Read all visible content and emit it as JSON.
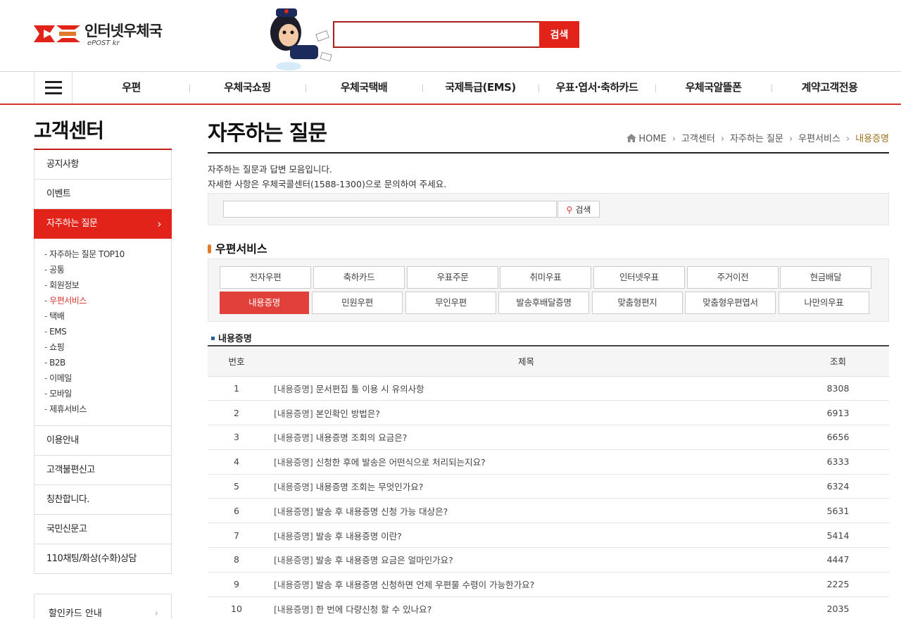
{
  "header": {
    "logo_text": "인터넷우체국",
    "logo_sub": "ePOST kr",
    "search_button": "검색",
    "search_value": ""
  },
  "gnb": {
    "items": [
      "우편",
      "우체국쇼핑",
      "우체국택배",
      "국제특급(EMS)",
      "우표·엽서·축하카드",
      "우체국알뜰폰",
      "계약고객전용"
    ]
  },
  "lnb": {
    "title": "고객센터",
    "items": [
      "공지사항",
      "이벤트",
      "자주하는 질문"
    ],
    "active_arrow": "›",
    "sub_items": [
      "자주하는 질문 TOP10",
      "공통",
      "회원정보",
      "우편서비스",
      "택배",
      "EMS",
      "쇼핑",
      "B2B",
      "이메일",
      "모바일",
      "제휴서비스"
    ],
    "items_after": [
      "이용안내",
      "고객불편신고",
      "칭찬합니다.",
      "국민신문고",
      "110채팅/화상(수화)상담"
    ],
    "bottom": "할인카드 안내"
  },
  "content": {
    "page_title": "자주하는 질문",
    "breadcrumb": [
      "HOME",
      "고객센터",
      "자주하는 질문",
      "우편서비스",
      "내용증명"
    ],
    "desc_line1": "자주하는 질문과 답변 모음입니다.",
    "desc_line2": "자세한 사항은 우체국콜센터(1588-1300)으로 문의하여 주세요.",
    "search_button": "검색",
    "category_title": "우편서비스",
    "categories_row1": [
      "전자우편",
      "축하카드",
      "우표주문",
      "취미우표",
      "인터넷우표",
      "주거이전",
      "현금배달"
    ],
    "categories_row2": [
      "내용증명",
      "민원우편",
      "무인우편",
      "발송후배달증명",
      "맞춤형편지",
      "맞춤형우편엽서",
      "나만의우표"
    ],
    "active_category": "내용증명",
    "sub_title": "내용증명",
    "table_headers": [
      "번호",
      "제목",
      "조회"
    ],
    "rows": [
      {
        "num": "1",
        "tag": "[내용증명]",
        "title": "문서편집 툴 이용 시 유의사항",
        "views": "8308"
      },
      {
        "num": "2",
        "tag": "[내용증명]",
        "title": "본인확인 방법은?",
        "views": "6913"
      },
      {
        "num": "3",
        "tag": "[내용증명]",
        "title": "내용증명 조회의 요금은?",
        "views": "6656"
      },
      {
        "num": "4",
        "tag": "[내용증명]",
        "title": "신청한 후에 발송은 어떤식으로 처리되는지요?",
        "views": "6333"
      },
      {
        "num": "5",
        "tag": "[내용증명]",
        "title": "내용증명 조회는 무엇인가요?",
        "views": "6324"
      },
      {
        "num": "6",
        "tag": "[내용증명]",
        "title": "발송 후 내용증명 신청 가능 대상은?",
        "views": "5631"
      },
      {
        "num": "7",
        "tag": "[내용증명]",
        "title": "발송 후 내용증명 이란?",
        "views": "5414"
      },
      {
        "num": "8",
        "tag": "[내용증명]",
        "title": "발송 후 내용증명 요금은 얼마인가요?",
        "views": "4447"
      },
      {
        "num": "9",
        "tag": "[내용증명]",
        "title": "발송 후 내용증명 신청하면 언제 우편물 수령이 가능한가요?",
        "views": "2225"
      },
      {
        "num": "10",
        "tag": "[내용증명]",
        "title": "한 번에 다량신청 할 수 있나요?",
        "views": "2035"
      }
    ]
  },
  "colors": {
    "brand_red": "#e2231a",
    "breadcrumb_current": "#a0721e"
  }
}
